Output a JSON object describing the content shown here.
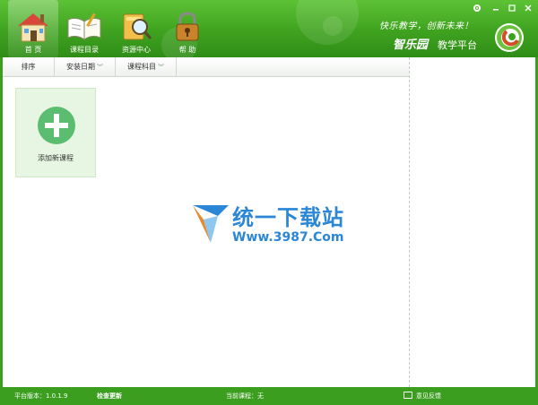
{
  "nav": {
    "items": [
      {
        "label": "首 页",
        "icon": "house-icon"
      },
      {
        "label": "课程目录",
        "icon": "book-icon"
      },
      {
        "label": "资源中心",
        "icon": "search-folder-icon"
      },
      {
        "label": "帮 助",
        "icon": "lock-icon"
      }
    ]
  },
  "window": {
    "settings_icon": "gear-icon",
    "minimize_icon": "minimize-icon",
    "maximize_icon": "maximize-icon",
    "close_icon": "close-icon"
  },
  "branding": {
    "slogan": "快乐教学，创新未来！",
    "brand": "智乐园",
    "platform": "教学平台"
  },
  "sortbar": {
    "sort_label": "排序",
    "install_date_label": "安装日期",
    "subject_label": "课程科目"
  },
  "content": {
    "add_course_label": "添加新课程"
  },
  "watermark": {
    "cn_text": "统一下载站",
    "url": "Www.3987.Com"
  },
  "status": {
    "version": "平台版本：1.0.1.9",
    "check_update": "检查更新",
    "current_course": "当前课程：无",
    "feedback": "意见反馈"
  },
  "colors": {
    "header_green": "#3fa21f",
    "card_bg": "#e6f6e2",
    "plus_green": "#5bbd70",
    "watermark_blue": "#2b86d6"
  }
}
